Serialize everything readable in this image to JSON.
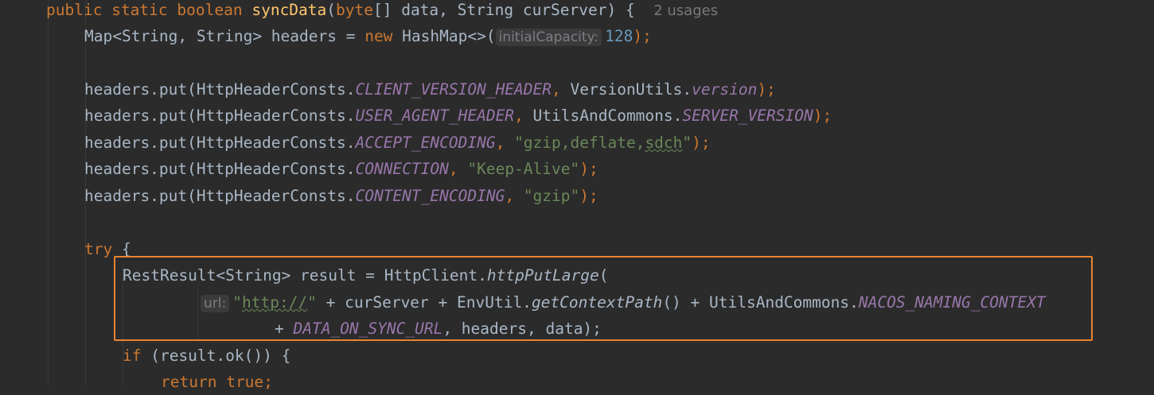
{
  "editor": {
    "lines": [
      {
        "id": "l1",
        "tokens": [
          "public",
          "static",
          "boolean",
          "syncData",
          "(",
          "byte",
          "[] data, String curServer) {"
        ],
        "usages": "2 usages"
      },
      {
        "id": "l2",
        "text_a": "Map<String, String> headers = ",
        "kw_new": "new",
        "text_b": " HashMap<>(",
        "hint": "initialCapacity:",
        "num": "128",
        "text_c": ");"
      },
      {
        "id": "l4",
        "a": "headers.put(HttpHeaderConsts.",
        "field": "CLIENT_VERSION_HEADER",
        "b": ", ",
        "c": "VersionUtils.",
        "field2": "version",
        "d": ");"
      },
      {
        "id": "l5",
        "a": "headers.put(HttpHeaderConsts.",
        "field": "USER_AGENT_HEADER",
        "b": ", ",
        "c": "UtilsAndCommons.",
        "field2": "SERVER_VERSION",
        "d": ");"
      },
      {
        "id": "l6",
        "a": "headers.put(HttpHeaderConsts.",
        "field": "ACCEPT_ENCODING",
        "b": ", ",
        "str_a": "\"gzip,deflate,",
        "str_b": "sdch",
        "str_c": "\"",
        "d": ");"
      },
      {
        "id": "l7",
        "a": "headers.put(HttpHeaderConsts.",
        "field": "CONNECTION",
        "b": ", ",
        "str": "\"Keep-Alive\"",
        "d": ");"
      },
      {
        "id": "l8",
        "a": "headers.put(HttpHeaderConsts.",
        "field": "CONTENT_ENCODING",
        "b": ", ",
        "str": "\"gzip\"",
        "d": ");"
      },
      {
        "id": "l10",
        "kw": "try",
        "rest": " {"
      },
      {
        "id": "l11",
        "a": "RestResult<String> result = HttpClient.",
        "method": "httpPutLarge",
        "b": "("
      },
      {
        "id": "l12",
        "hint": "url:",
        "str_a": "\"",
        "str_b": "http://",
        "str_c": "\"",
        "a": " + curServer + EnvUtil.",
        "method": "getContextPath",
        "b": "() + UtilsAndCommons.",
        "field": "NACOS_NAMING_CONTEXT"
      },
      {
        "id": "l13",
        "a": "+ ",
        "field": "DATA_ON_SYNC_URL",
        "b": ", headers, data);"
      },
      {
        "id": "l14",
        "kw": "if",
        "rest": " (result.ok()) {"
      },
      {
        "id": "l15",
        "kw1": "return",
        "kw2": "true",
        "rest": ";"
      }
    ]
  },
  "colors": {
    "background": "#2b2b2b",
    "keyword": "#cc7832",
    "function_decl": "#ffc66d",
    "static_field": "#9876aa",
    "string": "#6a8759",
    "number": "#6897bb",
    "default_text": "#a9b7c6",
    "highlight_border": "#e8852f"
  }
}
